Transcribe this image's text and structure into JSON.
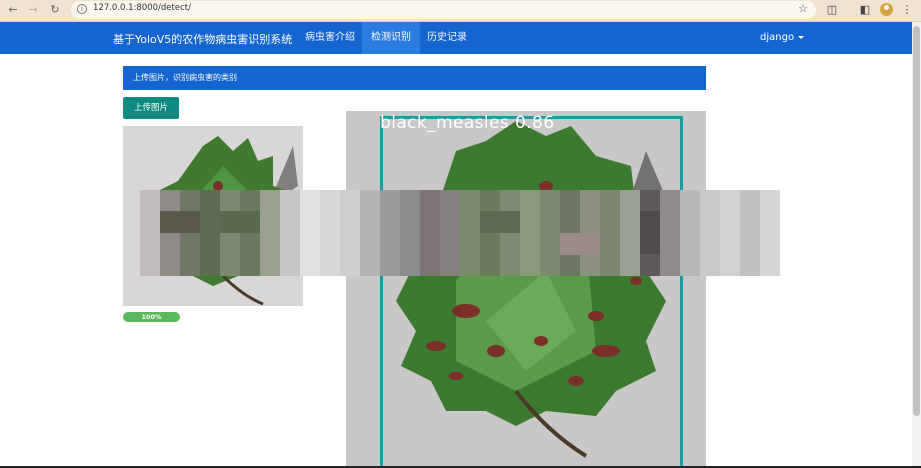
{
  "browser": {
    "url": "127.0.0.1:8000/detect/",
    "icons": [
      "back-icon",
      "forward-icon",
      "reload-icon",
      "info-icon",
      "star-icon",
      "extensions-icon",
      "side-panel-icon",
      "profile-icon",
      "menu-icon"
    ]
  },
  "navbar": {
    "brand": "基于YoloV5的农作物病虫害识别系统",
    "items": [
      {
        "label": "病虫害介绍"
      },
      {
        "label": "检测识别"
      },
      {
        "label": "历史记录"
      }
    ],
    "active_index": 1,
    "user": "django"
  },
  "main": {
    "banner": "上传图片，识别病虫害的类别",
    "upload_button": "上传图片",
    "progress_text": "100%",
    "progress_value": 100,
    "detection_label": "black_measles 0.86"
  },
  "colors": {
    "navbar": "#1565d0",
    "upload_button": "#0f8a82",
    "progress": "#5cb85c",
    "detection_box": "#1a9aa3"
  }
}
